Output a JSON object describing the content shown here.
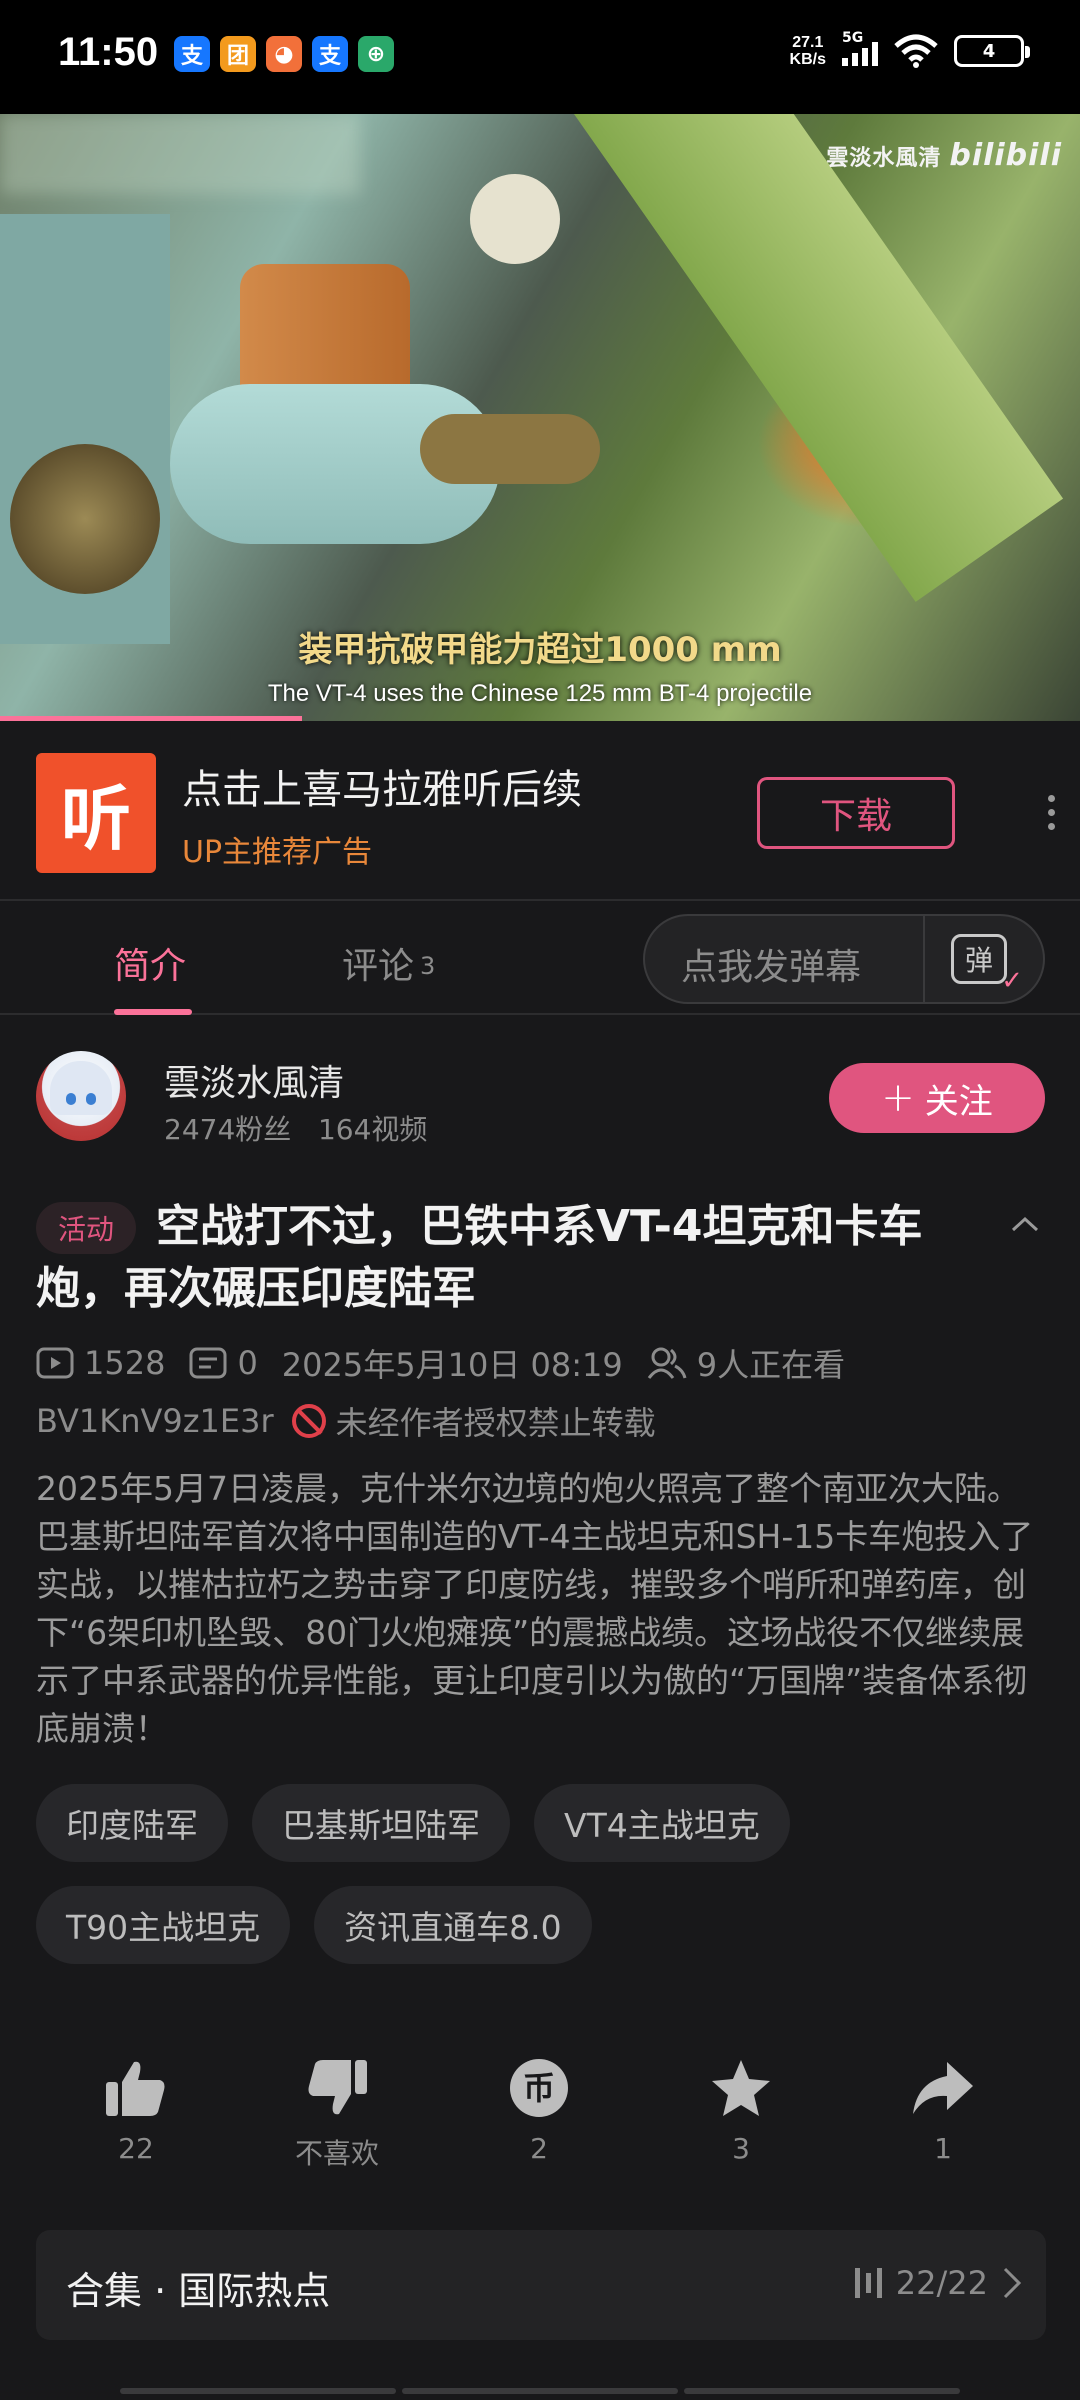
{
  "status_bar": {
    "time": "11:50",
    "apps": [
      {
        "icon": "alipay-icon",
        "glyph": "支",
        "color": "#1677ff"
      },
      {
        "icon": "meituan-icon",
        "glyph": "团",
        "color": "#f39a1d"
      },
      {
        "icon": "mascot-app-icon",
        "glyph": "◕",
        "color": "#f2703a"
      },
      {
        "icon": "alipay-icon",
        "glyph": "支",
        "color": "#1677ff"
      },
      {
        "icon": "bank-app-icon",
        "glyph": "⊕",
        "color": "#2aa86a"
      }
    ],
    "net_speed": "27.1",
    "net_unit": "KB/s",
    "signal_label": "5G",
    "battery": "4"
  },
  "video": {
    "watermark_name": "雲淡水風清",
    "watermark_brand": "bilibili",
    "subtitle_cn": "装甲抗破甲能力超过1000 mm",
    "subtitle_en": "The VT-4 uses the Chinese 125 mm BT-4 projectile",
    "progress": 0.28
  },
  "ad": {
    "logo_glyph": "听",
    "title": "点击上喜马拉雅听后续",
    "subtitle": "UP主推荐广告",
    "button": "下载"
  },
  "tabs": {
    "intro": "简介",
    "comments": "评论",
    "comments_count": "3",
    "danmaku_placeholder": "点我发弹幕",
    "danmaku_icon": "弹"
  },
  "uploader": {
    "name": "雲淡水風清",
    "followers": "2474粉丝",
    "videos": "164视频",
    "follow": "关注"
  },
  "video_info": {
    "badge": "活动",
    "title": "空战打不过，巴铁中系VT-4坦克和卡车炮，再次碾压印度陆军",
    "plays": "1528",
    "danmaku_count": "0",
    "date": "2025年5月10日 08:19",
    "watching": "9人正在看",
    "bvid": "BV1KnV9z1E3r",
    "copyright": "未经作者授权禁止转载",
    "description": "2025年5月7日凌晨，克什米尔边境的炮火照亮了整个南亚次大陆。巴基斯坦陆军首次将中国制造的VT-4主战坦克和SH-15卡车炮投入了实战，以摧枯拉朽之势击穿了印度防线，摧毁多个哨所和弹药库，创下“6架印机坠毁、80门火炮瘫痪”的震撼战绩。这场战役不仅继续展示了中系武器的优异性能，更让印度引以为傲的“万国牌”装备体系彻底崩溃！"
  },
  "tags": [
    "印度陆军",
    "巴基斯坦陆军",
    "VT4主战坦克",
    "T90主战坦克",
    "资讯直通车8.0"
  ],
  "actions": {
    "like": "22",
    "dislike": "不喜欢",
    "coin": "2",
    "favorite": "3",
    "share": "1"
  },
  "collection": {
    "title": "合集 · 国际热点",
    "progress": "22/22"
  }
}
